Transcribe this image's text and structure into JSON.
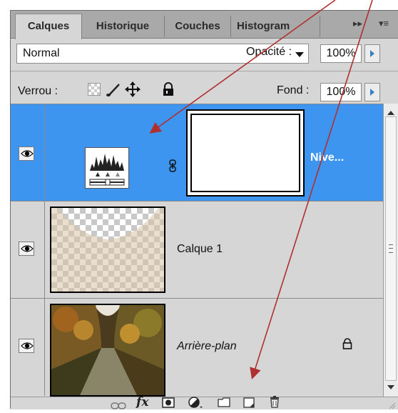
{
  "tabs": [
    {
      "label": "Calques",
      "active": true
    },
    {
      "label": "Historique",
      "active": false
    },
    {
      "label": "Couches",
      "active": false
    },
    {
      "label": "Histogram",
      "active": false
    }
  ],
  "tab_controls": {
    "expand": "▸▸",
    "menu": "▾≡"
  },
  "blend_mode": {
    "value": "Normal"
  },
  "opacity": {
    "label": "Opacité :",
    "value": "100%"
  },
  "lock": {
    "label": "Verrou :",
    "icons": [
      "lock-transparent-icon",
      "lock-brush-icon",
      "lock-move-icon",
      "lock-all-icon"
    ]
  },
  "fill": {
    "label": "Fond :",
    "value": "100%"
  },
  "layers": [
    {
      "name": "Nive...",
      "selected": true,
      "type": "adjustment-levels",
      "visible": true
    },
    {
      "name": "Calque 1",
      "selected": false,
      "type": "pixel",
      "visible": true
    },
    {
      "name": "Arrière-plan",
      "selected": false,
      "type": "background",
      "visible": true,
      "locked": true
    }
  ],
  "bottom_icons": [
    "link-icon",
    "fx-icon",
    "mask-icon",
    "adjustment-icon",
    "group-icon",
    "new-layer-icon",
    "trash-icon"
  ],
  "fx_label": "fx",
  "colors": {
    "selection": "#3d95ef",
    "panel": "#d6d6d6",
    "arrow": "#b03030"
  }
}
